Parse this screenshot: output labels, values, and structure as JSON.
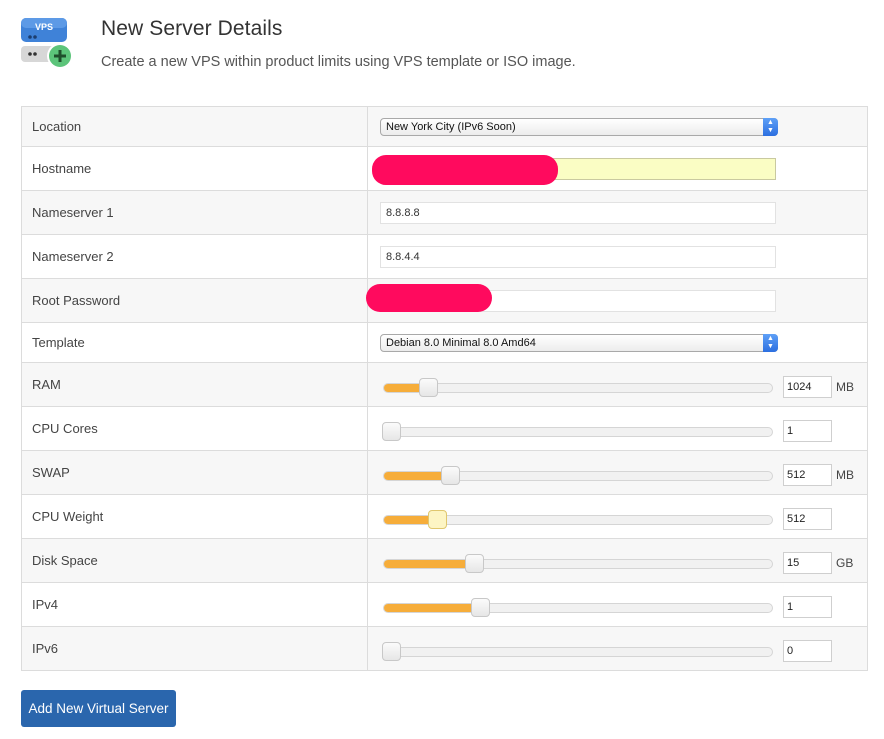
{
  "header": {
    "icon_text": "VPS",
    "title": "New Server Details",
    "subtitle": "Create a new VPS within product limits using VPS template or ISO image."
  },
  "form": {
    "location": {
      "label": "Location",
      "selected": "New York City (IPv6 Soon)"
    },
    "hostname": {
      "label": "Hostname",
      "value": ""
    },
    "ns1": {
      "label": "Nameserver 1",
      "value": "8.8.8.8"
    },
    "ns2": {
      "label": "Nameserver 2",
      "value": "8.8.4.4"
    },
    "password": {
      "label": "Root Password",
      "value": ""
    },
    "template": {
      "label": "Template",
      "selected": "Debian 8.0 Minimal 8.0 Amd64"
    },
    "sliders": [
      {
        "key": "ram",
        "label": "RAM",
        "value": "1024",
        "unit": "MB",
        "fraction": 0.115
      },
      {
        "key": "cpu-cores",
        "label": "CPU Cores",
        "value": "1",
        "unit": "",
        "fraction": 0.0
      },
      {
        "key": "swap",
        "label": "SWAP",
        "value": "512",
        "unit": "MB",
        "fraction": 0.172
      },
      {
        "key": "cpu-weight",
        "label": "CPU Weight",
        "value": "512",
        "unit": "",
        "fraction": 0.14,
        "focused": true
      },
      {
        "key": "disk-space",
        "label": "Disk Space",
        "value": "15",
        "unit": "GB",
        "fraction": 0.234
      },
      {
        "key": "ipv4",
        "label": "IPv4",
        "value": "1",
        "unit": "",
        "fraction": 0.25
      },
      {
        "key": "ipv6",
        "label": "IPv6",
        "value": "0",
        "unit": "",
        "fraction": 0.0
      }
    ]
  },
  "submit_label": "Add New Virtual Server",
  "colors": {
    "slider_fill": "#f6ad3a",
    "button": "#2a66ad",
    "redaction": "#ff0a5e",
    "autofill": "#fafdc4"
  }
}
